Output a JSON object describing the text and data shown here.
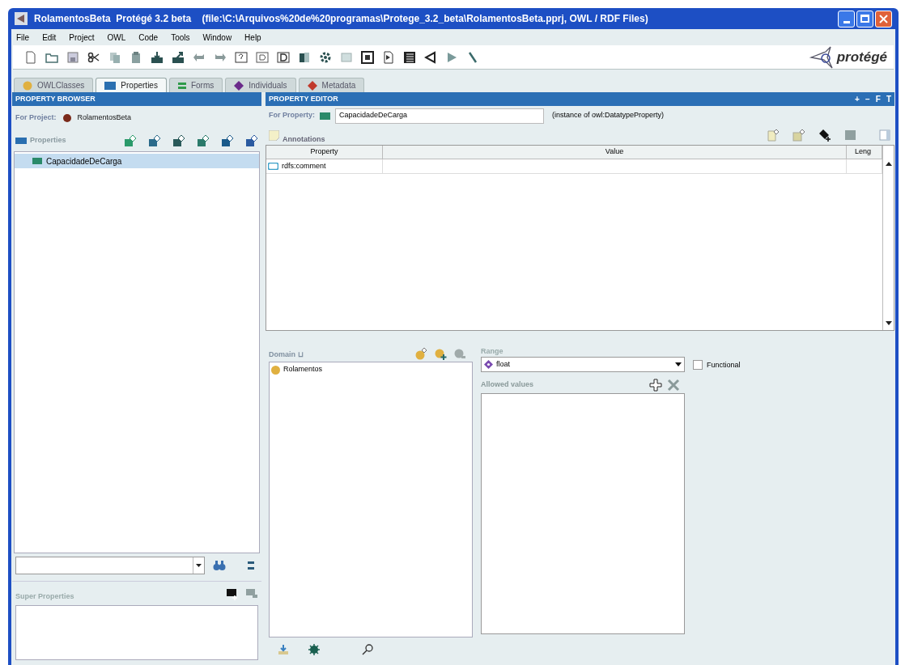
{
  "window": {
    "title": "RolamentosBeta  Protégé 3.2 beta    (file:\\C:\\Arquivos%20de%20programas\\Protege_3.2_beta\\RolamentosBeta.pprj, OWL / RDF Files)"
  },
  "menu": [
    "File",
    "Edit",
    "Project",
    "OWL",
    "Code",
    "Tools",
    "Window",
    "Help"
  ],
  "logo": {
    "text": "protégé"
  },
  "tabs": [
    {
      "label": "OWLClasses",
      "selected": false,
      "color": "#e0b040"
    },
    {
      "label": "Properties",
      "selected": true,
      "color": "#2a6fb0"
    },
    {
      "label": "Forms",
      "selected": false,
      "color": "#2f9a4a"
    },
    {
      "label": "Individuals",
      "selected": false,
      "color": "#6a2a8a"
    },
    {
      "label": "Metadata",
      "selected": false,
      "color": "#c0392b"
    }
  ],
  "header_controls": [
    "+",
    "−",
    "F",
    "T"
  ],
  "property_browser": {
    "title": "PROPERTY BROWSER",
    "for_project_label": "For Project:",
    "project": "RolamentosBeta",
    "section_label": "Properties",
    "items": [
      {
        "label": "CapacidadeDeCarga",
        "selected": true
      }
    ],
    "super_properties_label": "Super Properties"
  },
  "property_editor": {
    "title": "PROPERTY EDITOR",
    "for_property_label": "For Property:",
    "property": "CapacidadeDeCarga",
    "instance_of": "(instance of owl:DatatypeProperty)",
    "annotations_label": "Annotations",
    "table": {
      "columns": [
        "Property",
        "Value",
        "Leng"
      ],
      "rows": [
        {
          "property": "rdfs:comment"
        }
      ]
    },
    "domain_label": "Domain ⊔",
    "domain_items": [
      "Rolamentos"
    ],
    "range_label": "Range",
    "range_value": "float",
    "functional": {
      "label": "Functional",
      "checked": false
    },
    "allowed_values_label": "Allowed values"
  }
}
